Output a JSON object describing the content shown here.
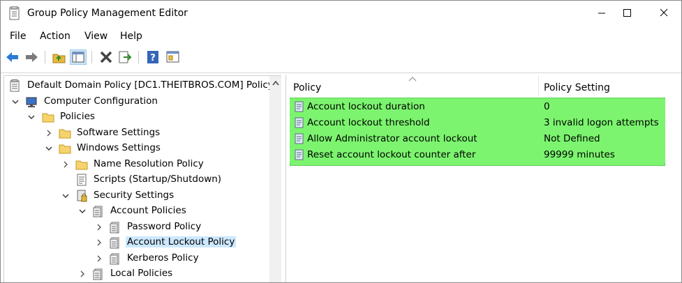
{
  "window": {
    "title": "Group Policy Management Editor"
  },
  "menu": {
    "file": "File",
    "action": "Action",
    "view": "View",
    "help": "Help"
  },
  "toolbar": [
    "back-icon",
    "forward-icon",
    "up-folder-icon",
    "show-hide-tree-icon",
    "delete-icon",
    "export-list-icon",
    "help-icon",
    "properties-icon"
  ],
  "tree": {
    "root": "Default Domain Policy [DC1.THEITBROS.COM] Policy",
    "computer_configuration": "Computer Configuration",
    "policies": "Policies",
    "software_settings": "Software Settings",
    "windows_settings": "Windows Settings",
    "name_resolution_policy": "Name Resolution Policy",
    "scripts": "Scripts (Startup/Shutdown)",
    "security_settings": "Security Settings",
    "account_policies": "Account Policies",
    "password_policy": "Password Policy",
    "account_lockout_policy": "Account Lockout Policy",
    "kerberos_policy": "Kerberos Policy",
    "local_policies": "Local Policies"
  },
  "list": {
    "columns": {
      "policy": "Policy",
      "setting": "Policy Setting"
    },
    "rows": [
      {
        "policy": "Account lockout duration",
        "setting": "0"
      },
      {
        "policy": "Account lockout threshold",
        "setting": "3 invalid logon attempts"
      },
      {
        "policy": "Allow Administrator account lockout",
        "setting": "Not Defined"
      },
      {
        "policy": "Reset account lockout counter after",
        "setting": "99999 minutes"
      }
    ],
    "highlight_color": "#7cf46f"
  },
  "colors": {
    "selection": "#cce8ff",
    "folder": "#f2c94c",
    "toolbar_pressed": "#cce4f7"
  }
}
